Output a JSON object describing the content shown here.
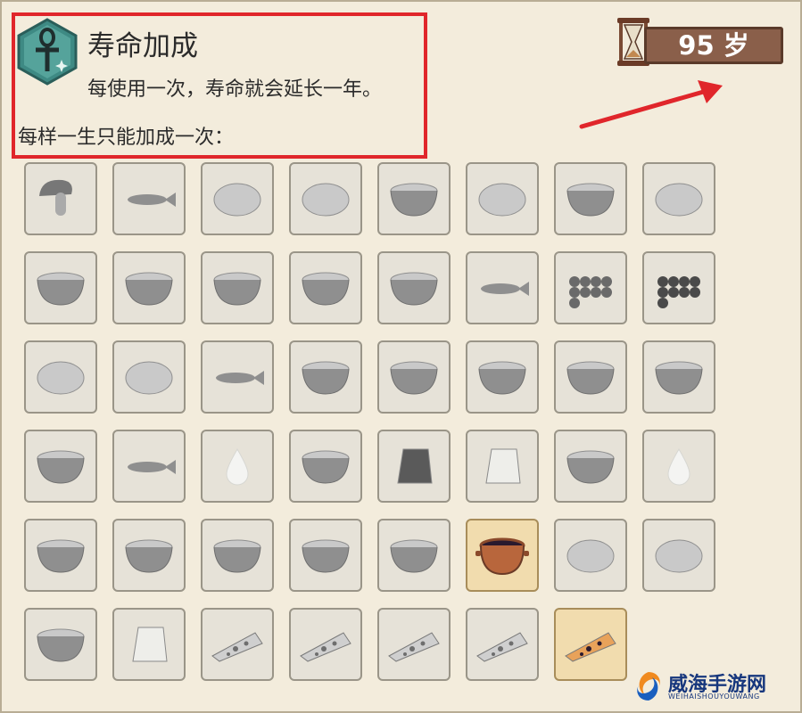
{
  "header": {
    "title": "寿命加成",
    "description": "每使用一次，寿命就会延长一年。",
    "limit_note": "每样一生只能加成一次："
  },
  "age_display": {
    "value": "95 岁",
    "icon": "hourglass-icon"
  },
  "colors": {
    "highlight_border": "#e0262b",
    "arrow": "#e0262b",
    "slot_bg": "#e6e2d8",
    "slot_active_bg": "#f1dcae",
    "age_box": "#8a5f4a"
  },
  "food_items": [
    {
      "name": "mushroom",
      "active": false
    },
    {
      "name": "skinned-animal",
      "active": false
    },
    {
      "name": "egg",
      "active": false
    },
    {
      "name": "meat-slab",
      "active": false
    },
    {
      "name": "bowl-grain",
      "active": false
    },
    {
      "name": "flat-meat",
      "active": false
    },
    {
      "name": "round-cake",
      "active": false
    },
    {
      "name": "plucked-bird",
      "active": false
    },
    {
      "name": "pie-dish",
      "active": false
    },
    {
      "name": "bowl-stew",
      "active": false
    },
    {
      "name": "bowl-porridge",
      "active": false
    },
    {
      "name": "bowl-soup",
      "active": false
    },
    {
      "name": "bowl-dark-stew",
      "active": false
    },
    {
      "name": "fish",
      "active": false
    },
    {
      "name": "berry-pile",
      "active": false
    },
    {
      "name": "bead-pile",
      "active": false
    },
    {
      "name": "bread-loaves",
      "active": false
    },
    {
      "name": "smoked-meat",
      "active": false
    },
    {
      "name": "raw-fish",
      "active": false
    },
    {
      "name": "pot-beans",
      "active": false
    },
    {
      "name": "pot-stew",
      "active": false
    },
    {
      "name": "pot-soup",
      "active": false
    },
    {
      "name": "deep-bowl-stew",
      "active": false
    },
    {
      "name": "deep-bowl-porridge",
      "active": false
    },
    {
      "name": "deep-bowl-grain",
      "active": false
    },
    {
      "name": "lizard",
      "active": false
    },
    {
      "name": "water-drop",
      "active": false
    },
    {
      "name": "deep-bowl-beans",
      "active": false
    },
    {
      "name": "dark-cheese-block",
      "active": false
    },
    {
      "name": "white-cheese-block",
      "active": false
    },
    {
      "name": "bowl-milk",
      "active": false
    },
    {
      "name": "water-drop-2",
      "active": false
    },
    {
      "name": "half-fruit",
      "active": false
    },
    {
      "name": "cracked-bowl",
      "active": false
    },
    {
      "name": "deep-bowl-broth",
      "active": false
    },
    {
      "name": "cake-wheel",
      "active": false
    },
    {
      "name": "bowl-mixed",
      "active": false
    },
    {
      "name": "clay-pot-wine",
      "active": true
    },
    {
      "name": "round-bun",
      "active": false
    },
    {
      "name": "cloth-wrap",
      "active": false
    },
    {
      "name": "wide-bowl",
      "active": false
    },
    {
      "name": "cheese-wedge",
      "active": false
    },
    {
      "name": "pizza-slice",
      "active": false
    },
    {
      "name": "pizza-slice-2",
      "active": false
    },
    {
      "name": "pizza-slice-3",
      "active": false
    },
    {
      "name": "pizza-slice-4",
      "active": false
    },
    {
      "name": "pizza-slice-baked",
      "active": true
    }
  ],
  "watermark": {
    "text": "威海手游网",
    "subtext": "WEIHAISHOUYOUWANG"
  }
}
